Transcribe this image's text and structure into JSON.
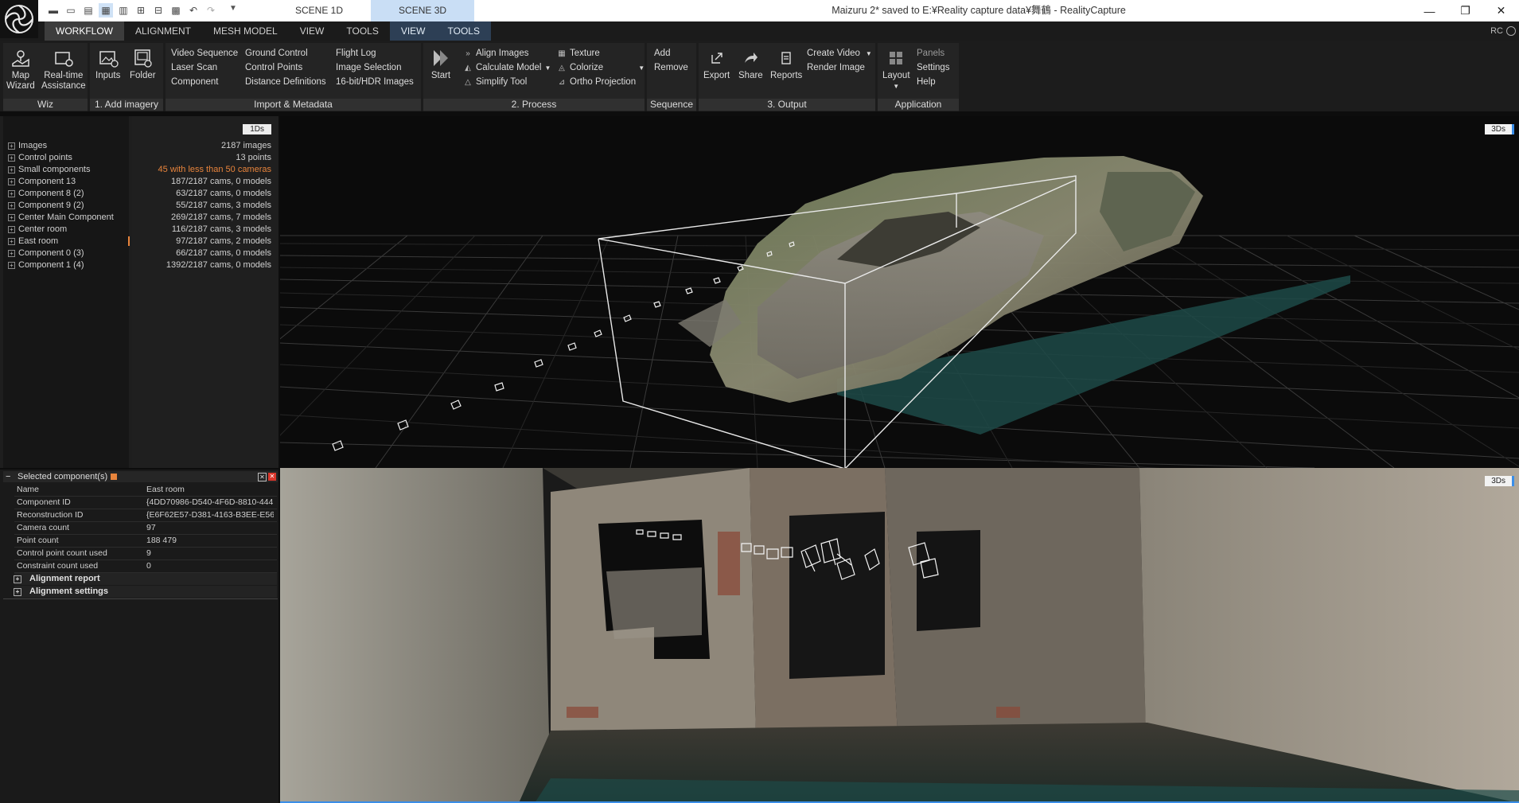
{
  "titlebar": {
    "scene_tabs": [
      "SCENE 1D",
      "SCENE 3D"
    ],
    "window_title": "Maizuru 2* saved to E:¥Reality capture data¥舞鶴 - RealityCapture"
  },
  "menubar": {
    "items": [
      "WORKFLOW",
      "ALIGNMENT",
      "MESH MODEL",
      "VIEW",
      "TOOLS",
      "VIEW",
      "TOOLS"
    ],
    "rc_label": "RC"
  },
  "ribbon": {
    "wiz": {
      "label": "Wiz",
      "map_wizard": "Map\nWizard",
      "realtime": "Real-time\nAssistance"
    },
    "add_imagery": {
      "label": "1. Add imagery",
      "inputs": "Inputs",
      "folder": "Folder"
    },
    "import": {
      "label": "Import & Metadata",
      "col1": [
        "Video Sequence",
        "Laser Scan",
        "Component"
      ],
      "col2": [
        "Ground Control",
        "Control Points",
        "Distance Definitions"
      ],
      "col3": [
        "Flight Log",
        "Image Selection",
        "16-bit/HDR Images"
      ]
    },
    "process": {
      "label": "2. Process",
      "start": "Start",
      "col1": [
        "Align Images",
        "Calculate Model",
        "Simplify Tool"
      ],
      "col2": [
        "Texture",
        "Colorize",
        "Ortho Projection"
      ]
    },
    "sequence": {
      "label": "Sequence",
      "add": "Add",
      "remove": "Remove"
    },
    "output": {
      "label": "3. Output",
      "export": "Export",
      "share": "Share",
      "reports": "Reports",
      "create_video": "Create Video",
      "render_image": "Render Image"
    },
    "application": {
      "label": "Application",
      "layout": "Layout",
      "panels": "Panels",
      "settings": "Settings",
      "help": "Help"
    }
  },
  "panel_1ds": {
    "tag": "1Ds",
    "rows": [
      {
        "name": "Images",
        "value": "2187 images"
      },
      {
        "name": "Control points",
        "value": "13 points"
      },
      {
        "name": "Small components",
        "value": "45 with less than 50 cameras"
      },
      {
        "name": "Component 13",
        "value": "187/2187 cams, 0 models"
      },
      {
        "name": "Component 8 (2)",
        "value": "63/2187 cams, 0 models"
      },
      {
        "name": "Component 9 (2)",
        "value": "55/2187 cams, 3 models"
      },
      {
        "name": "Center Main Component",
        "value": "269/2187 cams, 7 models"
      },
      {
        "name": "Center room",
        "value": "116/2187 cams, 3 models"
      },
      {
        "name": "East room",
        "value": "97/2187 cams, 2 models"
      },
      {
        "name": "Component 0 (3)",
        "value": "66/2187 cams, 0 models"
      },
      {
        "name": "Component 1 (4)",
        "value": "1392/2187 cams, 0 models"
      }
    ]
  },
  "selected": {
    "title": "Selected component(s)",
    "props": [
      {
        "name": "Name",
        "value": "East room"
      },
      {
        "name": "Component ID",
        "value": "{4DD70986-D540-4F6D-8810-444..."
      },
      {
        "name": "Reconstruction ID",
        "value": "{E6F62E57-D381-4163-B3EE-E56..."
      },
      {
        "name": "Camera count",
        "value": "97"
      },
      {
        "name": "Point count",
        "value": "188 479"
      },
      {
        "name": "Control point count used",
        "value": "9"
      },
      {
        "name": "Constraint count used",
        "value": "0"
      }
    ],
    "sections": [
      "Alignment report",
      "Alignment settings"
    ]
  },
  "viewports": {
    "top_tag": "3Ds",
    "bottom_tag": "3Ds"
  }
}
